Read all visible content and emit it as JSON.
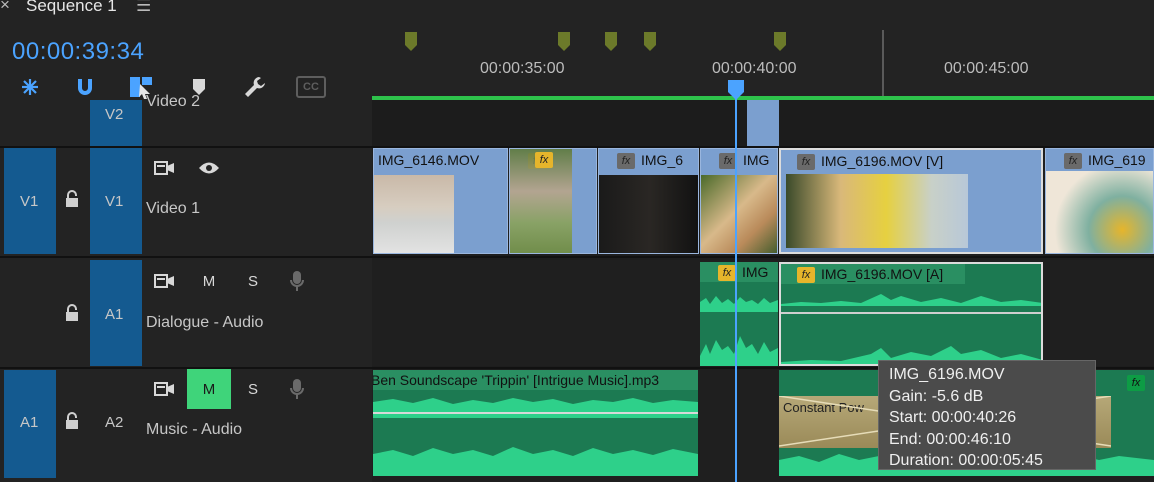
{
  "tab": {
    "close": "×",
    "title": "Sequence 1",
    "menu": "☰"
  },
  "timecode": "00:00:39:34",
  "toolbar": {
    "icons": [
      "nest-icon",
      "snap-icon",
      "linked-selection-icon",
      "add-marker-icon",
      "settings-wrench-icon",
      "captions-icon"
    ],
    "cc_label": "CC"
  },
  "ruler": {
    "labels": [
      "00:00:35:00",
      "00:00:40:00",
      "00:00:45:00"
    ]
  },
  "colors": {
    "accent": "#4ba3ff",
    "track_blue": "#145a90",
    "video_clip": "#7b9fcf",
    "audio_clip": "#1c7a52",
    "playback_bar": "#2ec24b",
    "mute_active": "#3fd47a"
  },
  "tracks": {
    "v2": {
      "label": "V2",
      "name": "Video 2"
    },
    "v1": {
      "source": "V1",
      "label": "V1",
      "name": "Video 1"
    },
    "a1": {
      "label": "A1",
      "name": "Dialogue - Audio",
      "m": "M",
      "s": "S"
    },
    "a2": {
      "source": "A1",
      "label": "A2",
      "name": "Music - Audio",
      "m": "M",
      "s": "S"
    }
  },
  "clips": {
    "v_6146": "IMG_6146.MOV",
    "v_short": "IMG_6",
    "v_img": "IMG",
    "v_6196": "IMG_6196.MOV [V]",
    "v_619": "IMG_619",
    "a_img": "IMG",
    "a_6196": "IMG_6196.MOV [A]",
    "music": "Ben Soundscape 'Trippin' [Intrigue Music].mp3",
    "transition": "Constant Pow",
    "fx": "fx"
  },
  "tooltip": {
    "line1": "IMG_6196.MOV",
    "line2": "Gain: -5.6 dB",
    "line3": "Start: 00:00:40:26",
    "line4": "End: 00:00:46:10",
    "line5": "Duration: 00:00:05:45"
  }
}
